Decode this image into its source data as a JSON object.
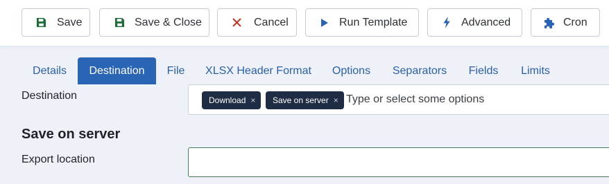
{
  "toolbar": {
    "save": {
      "label": "Save",
      "icon": "save-icon"
    },
    "save_close": {
      "label": "Save & Close",
      "icon": "save-icon"
    },
    "cancel": {
      "label": "Cancel",
      "icon": "close-icon"
    },
    "run_template": {
      "label": "Run Template",
      "icon": "play-icon"
    },
    "advanced": {
      "label": "Advanced",
      "icon": "bolt-icon"
    },
    "cron": {
      "label": "Cron",
      "icon": "puzzle-icon"
    }
  },
  "tabs": [
    {
      "label": "Details",
      "active": false
    },
    {
      "label": "Destination",
      "active": true
    },
    {
      "label": "File",
      "active": false
    },
    {
      "label": "XLSX Header Format",
      "active": false
    },
    {
      "label": "Options",
      "active": false
    },
    {
      "label": "Separators",
      "active": false
    },
    {
      "label": "Fields",
      "active": false
    },
    {
      "label": "Limits",
      "active": false
    }
  ],
  "form": {
    "destination_label": "Destination",
    "destination_chips": [
      "Download",
      "Save on server"
    ],
    "chip_remove": "×",
    "destination_placeholder": "Type or select some options",
    "section_title": "Save on server",
    "export_location_label": "Export location",
    "export_location_value": ""
  },
  "colors": {
    "accent": "#2a64b4",
    "save_icon": "#1e6b3a",
    "cancel_icon": "#c0392b",
    "primary_icon": "#2a64b4",
    "chip_bg": "#1f2d44"
  }
}
